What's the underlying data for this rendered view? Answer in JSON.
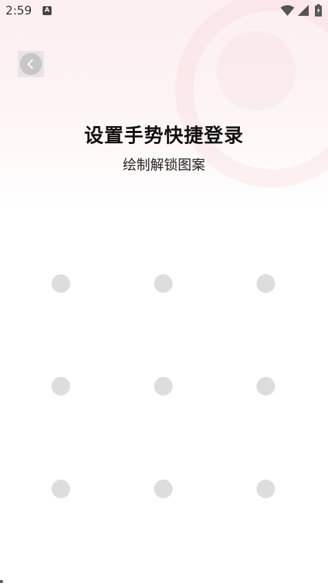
{
  "status_bar": {
    "time": "2:59",
    "notification_letter": "A"
  },
  "page": {
    "title": "设置手势快捷登录",
    "subtitle": "绘制解锁图案"
  },
  "pattern": {
    "rows": 3,
    "cols": 3,
    "dot_color": "#dddddd"
  },
  "colors": {
    "header_tint": "#fdeff1",
    "back_button_bg": "#c9c6c7"
  }
}
